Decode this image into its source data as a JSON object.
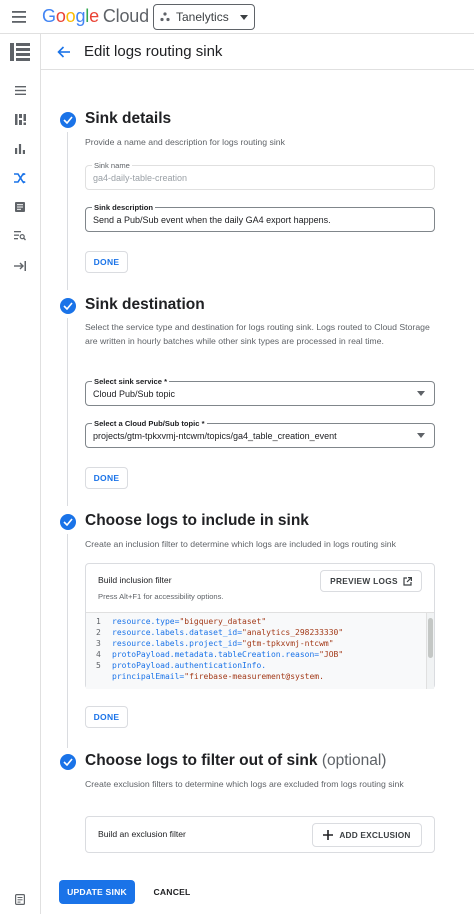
{
  "topbar": {
    "logo_parts": [
      "G",
      "o",
      "o",
      "g",
      "l",
      "e"
    ],
    "logo_cloud": "Cloud",
    "project_name": "Tanelytics"
  },
  "header": {
    "title": "Edit logs routing sink"
  },
  "colors": {
    "primary": "#1a73e8",
    "text": "#202124",
    "secondary_text": "#5f6368",
    "border": "#dadce0",
    "code_keyword": "#1a73e8",
    "code_string": "#a33b1a"
  },
  "steps": {
    "details": {
      "title": "Sink details",
      "description": "Provide a name and description for logs routing sink",
      "name_label": "Sink name",
      "name_value": "ga4-daily-table-creation",
      "desc_label": "Sink description",
      "desc_value": "Send a Pub/Sub event when the daily GA4 export happens.",
      "done_label": "DONE"
    },
    "destination": {
      "title": "Sink destination",
      "description": "Select the service type and destination for logs routing sink. Logs routed to Cloud Storage are written in hourly batches while other sink types are processed in real time.",
      "service_label": "Select sink service *",
      "service_value": "Cloud Pub/Sub topic",
      "topic_label": "Select a Cloud Pub/Sub topic *",
      "topic_value": "projects/gtm-tpkxvmj-ntcwm/topics/ga4_table_creation_event",
      "done_label": "DONE"
    },
    "include": {
      "title": "Choose logs to include in sink",
      "description": "Create an inclusion filter to determine which logs are included in logs routing sink",
      "filter_title": "Build inclusion filter",
      "filter_hint": "Press Alt+F1 for accessibility options.",
      "preview_label": "PREVIEW LOGS",
      "code_lines": [
        {
          "num": "1",
          "text": "resource.type=",
          "str": "\"bigquery_dataset\""
        },
        {
          "num": "2",
          "text": "resource.labels.dataset_id=",
          "str": "\"analytics_298233330\""
        },
        {
          "num": "3",
          "text": "resource.labels.project_id=",
          "str": "\"gtm-tpkxvmj-ntcwm\""
        },
        {
          "num": "4",
          "text": "protoPayload.metadata.tableCreation.reason=",
          "str": "\"JOB\""
        },
        {
          "num": "5",
          "text": "protoPayload.authenticationInfo.",
          "str": ""
        },
        {
          "num": "",
          "text": "principalEmail=",
          "str": "\"firebase-measurement@system."
        }
      ],
      "done_label": "DONE"
    },
    "exclude": {
      "title": "Choose logs to filter out of sink",
      "optional": "(optional)",
      "description": "Create exclusion filters to determine which logs are excluded from logs routing sink",
      "filter_title": "Build an exclusion filter",
      "add_label": "ADD EXCLUSION"
    }
  },
  "footer": {
    "update_label": "UPDATE SINK",
    "cancel_label": "CANCEL"
  }
}
